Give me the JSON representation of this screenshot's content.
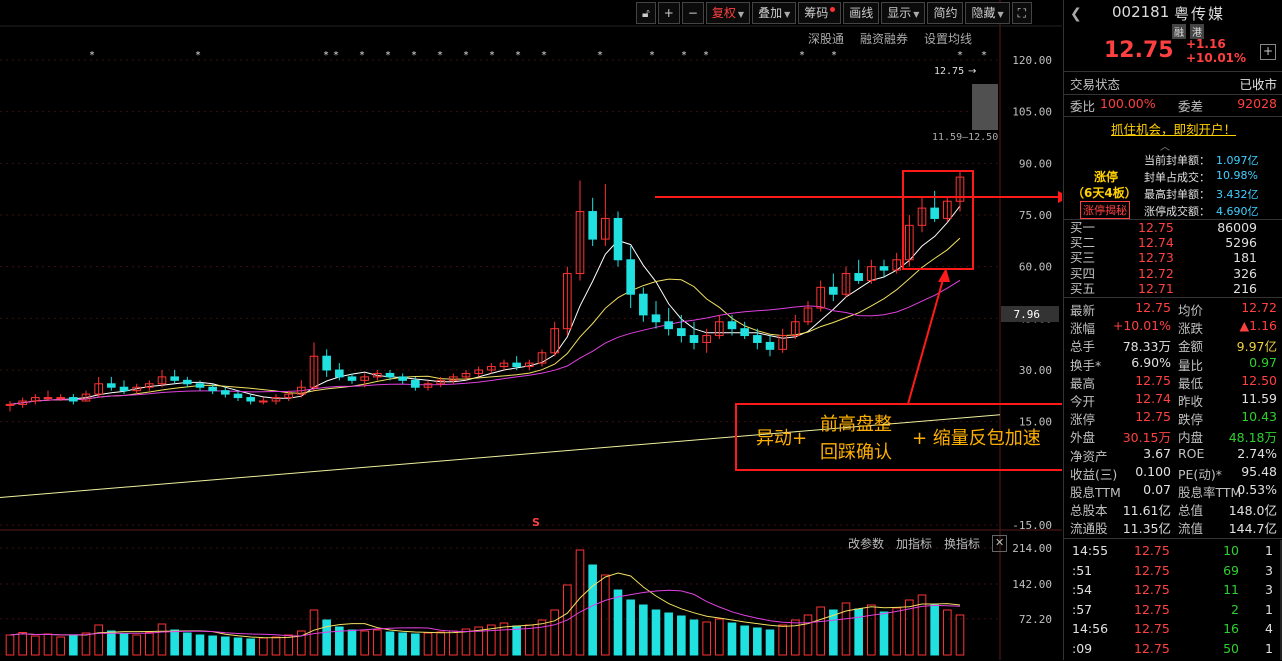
{
  "toolbar": {
    "restore": "复权",
    "overlay": "叠加",
    "chips": "筹码",
    "draw": "画线",
    "display": "显示",
    "simple": "简约",
    "hide": "隐藏",
    "plus": "+",
    "minus": "−"
  },
  "subbar": {
    "sgt": "深股通",
    "margin": "融资融券",
    "ma_settings": "设置均线"
  },
  "volbar": {
    "edit_params": "改参数",
    "add_indicator": "加指标",
    "switch_indicator": "换指标"
  },
  "price_axis": [
    "120.00",
    "105.00",
    "90.00",
    "75.00",
    "60.00",
    "45.00",
    "30.00",
    "15.00",
    "-15.00"
  ],
  "vol_axis": [
    "214.00",
    "142.00",
    "72.20"
  ],
  "marker_current": "7.96",
  "annotations": {
    "price_label": "12.75",
    "range_label": "11.59—12.50",
    "s_marker": "S",
    "anno_part1": "异动+",
    "anno_part2a": "前高盘整",
    "anno_part2b": "回踩确认",
    "anno_part3": "+ 缩量反包加速"
  },
  "chart_data": {
    "type": "candlestick",
    "ylim": [
      -15,
      120
    ],
    "candles": [
      [
        20,
        21,
        18,
        20
      ],
      [
        20,
        22,
        19,
        21
      ],
      [
        21,
        23,
        20,
        22
      ],
      [
        22,
        24,
        21,
        22
      ],
      [
        22,
        23,
        21,
        22
      ],
      [
        22,
        23,
        20,
        21
      ],
      [
        21,
        24,
        21,
        23
      ],
      [
        23,
        28,
        22,
        26
      ],
      [
        26,
        28,
        24,
        25
      ],
      [
        25,
        27,
        23,
        24
      ],
      [
        24,
        26,
        23,
        25
      ],
      [
        25,
        27,
        24,
        26
      ],
      [
        26,
        30,
        25,
        28
      ],
      [
        28,
        30,
        26,
        27
      ],
      [
        27,
        28,
        25,
        26
      ],
      [
        26,
        27,
        24,
        25
      ],
      [
        25,
        26,
        23,
        24
      ],
      [
        24,
        25,
        22,
        23
      ],
      [
        23,
        24,
        21,
        22
      ],
      [
        22,
        23,
        20,
        21
      ],
      [
        21,
        22,
        20,
        21
      ],
      [
        21,
        23,
        20,
        22
      ],
      [
        22,
        24,
        21,
        23
      ],
      [
        23,
        27,
        22,
        25
      ],
      [
        25,
        38,
        24,
        34
      ],
      [
        34,
        36,
        28,
        30
      ],
      [
        30,
        32,
        27,
        28
      ],
      [
        28,
        29,
        26,
        27
      ],
      [
        27,
        29,
        25,
        28
      ],
      [
        28,
        30,
        27,
        29
      ],
      [
        29,
        30,
        27,
        28
      ],
      [
        28,
        29,
        26,
        27
      ],
      [
        27,
        28,
        24,
        25
      ],
      [
        25,
        27,
        24,
        26
      ],
      [
        26,
        28,
        25,
        27
      ],
      [
        27,
        29,
        26,
        28
      ],
      [
        28,
        30,
        27,
        29
      ],
      [
        29,
        31,
        28,
        30
      ],
      [
        30,
        32,
        29,
        31
      ],
      [
        31,
        33,
        30,
        32
      ],
      [
        32,
        34,
        30,
        31
      ],
      [
        31,
        33,
        30,
        32
      ],
      [
        32,
        36,
        31,
        35
      ],
      [
        35,
        44,
        34,
        42
      ],
      [
        42,
        60,
        40,
        58
      ],
      [
        58,
        85,
        56,
        76
      ],
      [
        76,
        80,
        66,
        68
      ],
      [
        68,
        84,
        66,
        74
      ],
      [
        74,
        76,
        60,
        62
      ],
      [
        62,
        66,
        48,
        52
      ],
      [
        52,
        54,
        44,
        46
      ],
      [
        46,
        50,
        42,
        44
      ],
      [
        44,
        48,
        40,
        42
      ],
      [
        42,
        46,
        38,
        40
      ],
      [
        40,
        44,
        36,
        38
      ],
      [
        38,
        42,
        35,
        40
      ],
      [
        40,
        46,
        39,
        44
      ],
      [
        44,
        46,
        40,
        42
      ],
      [
        42,
        44,
        39,
        40
      ],
      [
        40,
        42,
        36,
        38
      ],
      [
        38,
        40,
        34,
        36
      ],
      [
        36,
        42,
        35,
        40
      ],
      [
        40,
        46,
        39,
        44
      ],
      [
        44,
        50,
        43,
        48
      ],
      [
        48,
        56,
        47,
        54
      ],
      [
        54,
        58,
        50,
        52
      ],
      [
        52,
        60,
        51,
        58
      ],
      [
        58,
        62,
        55,
        56
      ],
      [
        56,
        62,
        55,
        60
      ],
      [
        60,
        62,
        57,
        59
      ],
      [
        59,
        64,
        58,
        62
      ],
      [
        62,
        75,
        60,
        72
      ],
      [
        72,
        80,
        70,
        77
      ],
      [
        77,
        82,
        73,
        74
      ],
      [
        74,
        80,
        73,
        79
      ],
      [
        79,
        88,
        76,
        86
      ]
    ],
    "volume": [
      40,
      45,
      38,
      42,
      36,
      40,
      44,
      60,
      48,
      42,
      40,
      45,
      62,
      50,
      44,
      40,
      38,
      36,
      34,
      32,
      34,
      36,
      40,
      48,
      90,
      70,
      56,
      50,
      48,
      50,
      46,
      44,
      42,
      44,
      46,
      48,
      52,
      56,
      60,
      64,
      58,
      60,
      70,
      90,
      140,
      210,
      180,
      160,
      130,
      110,
      100,
      90,
      84,
      78,
      70,
      66,
      72,
      64,
      58,
      54,
      50,
      60,
      70,
      80,
      96,
      90,
      104,
      92,
      100,
      86,
      94,
      110,
      120,
      100,
      90,
      80
    ]
  },
  "stock": {
    "code": "002181",
    "name": "粤传媒",
    "tag_margin": "融",
    "tag_hk": "港",
    "price": "12.75",
    "change": "+1.16",
    "change_pct": "+10.01%"
  },
  "status": {
    "label": "交易状态",
    "value": "已收市"
  },
  "ratio": {
    "label1": "委比",
    "value1": "100.00%",
    "label2": "委差",
    "value2": "92028"
  },
  "promo": "抓住机会，即刻开户！",
  "limit_up": {
    "title": "涨停",
    "days": "（6天4板）",
    "reveal": "涨停揭秘",
    "rows": [
      {
        "label": "当前封单额：",
        "value": "1.097亿"
      },
      {
        "label": "封单占成交：",
        "value": "10.98%"
      },
      {
        "label": "最高封单额：",
        "value": "3.432亿"
      },
      {
        "label": "涨停成交额：",
        "value": "4.690亿"
      }
    ]
  },
  "bids": [
    {
      "label": "买一",
      "price": "12.75",
      "vol": "86009"
    },
    {
      "label": "买二",
      "price": "12.74",
      "vol": "5296"
    },
    {
      "label": "买三",
      "price": "12.73",
      "vol": "181"
    },
    {
      "label": "买四",
      "price": "12.72",
      "vol": "326"
    },
    {
      "label": "买五",
      "price": "12.71",
      "vol": "216"
    }
  ],
  "quote": [
    {
      "l1": "最新",
      "v1": "12.75",
      "c1": "r",
      "l2": "均价",
      "v2": "12.72",
      "c2": "r"
    },
    {
      "l1": "涨幅",
      "v1": "+10.01%",
      "c1": "r",
      "l2": "涨跌",
      "v2": "▲1.16",
      "c2": "r"
    },
    {
      "l1": "总手",
      "v1": "78.33万",
      "c1": "w",
      "l2": "金额",
      "v2": "9.97亿",
      "c2": "y"
    },
    {
      "l1": "换手*",
      "v1": "6.90%",
      "c1": "w",
      "l2": "量比",
      "v2": "0.97",
      "c2": "g"
    },
    {
      "l1": "最高",
      "v1": "12.75",
      "c1": "r",
      "l2": "最低",
      "v2": "12.50",
      "c2": "r"
    },
    {
      "l1": "今开",
      "v1": "12.74",
      "c1": "r",
      "l2": "昨收",
      "v2": "11.59",
      "c2": "w"
    },
    {
      "l1": "涨停",
      "v1": "12.75",
      "c1": "r",
      "l2": "跌停",
      "v2": "10.43",
      "c2": "g"
    },
    {
      "l1": "外盘",
      "v1": "30.15万",
      "c1": "r",
      "l2": "内盘",
      "v2": "48.18万",
      "c2": "g"
    },
    {
      "l1": "净资产",
      "v1": "3.67",
      "c1": "w",
      "l2": "ROE",
      "v2": "2.74%",
      "c2": "w"
    },
    {
      "l1": "收益(三)",
      "v1": "0.100",
      "c1": "w",
      "l2": "PE(动)*",
      "v2": "95.48",
      "c2": "w"
    },
    {
      "l1": "股息TTM",
      "v1": "0.07",
      "c1": "w",
      "l2": "股息率TTM",
      "v2": "0.53%",
      "c2": "w"
    },
    {
      "l1": "总股本",
      "v1": "11.61亿",
      "c1": "w",
      "l2": "总值",
      "v2": "148.0亿",
      "c2": "w"
    },
    {
      "l1": "流通股",
      "v1": "11.35亿",
      "c1": "w",
      "l2": "流值",
      "v2": "144.7亿",
      "c2": "w"
    }
  ],
  "ticks": [
    {
      "time": "14:55",
      "price": "12.75",
      "vol": "10",
      "cnt": "1"
    },
    {
      "time": ":51",
      "price": "12.75",
      "vol": "69",
      "cnt": "3"
    },
    {
      "time": ":54",
      "price": "12.75",
      "vol": "11",
      "cnt": "3"
    },
    {
      "time": ":57",
      "price": "12.75",
      "vol": "2",
      "cnt": "1"
    },
    {
      "time": "14:56",
      "price": "12.75",
      "vol": "16",
      "cnt": "4"
    },
    {
      "time": ":09",
      "price": "12.75",
      "vol": "50",
      "cnt": "1"
    }
  ],
  "colors": {
    "up": "#ff3232",
    "down": "#20e0e0",
    "ma5": "#ffffff",
    "ma10": "#f0e060",
    "ma20": "#e040e0",
    "ma250": "#f0f0a0",
    "grid": "#3a1010"
  }
}
